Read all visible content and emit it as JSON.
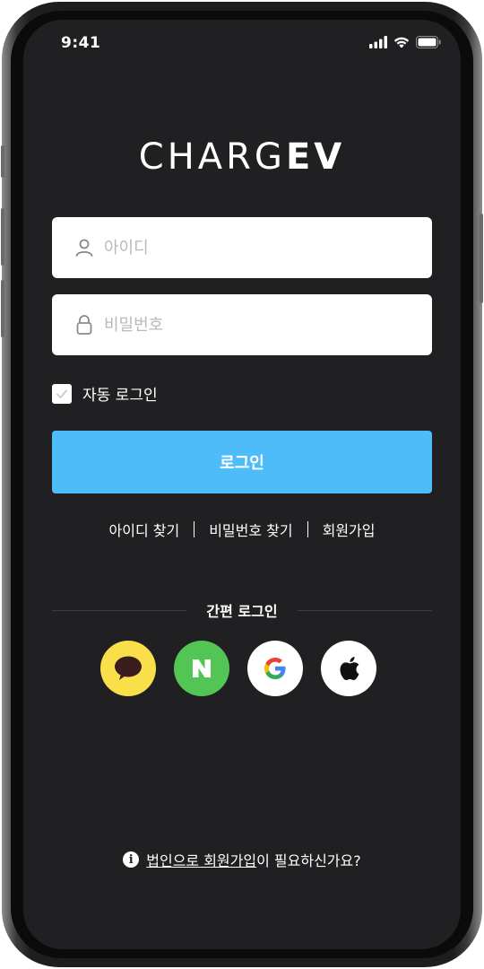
{
  "status_bar": {
    "time": "9:41",
    "icons": [
      "cellular-signal-icon",
      "wifi-icon",
      "battery-icon"
    ]
  },
  "logo": {
    "part_thin": "CHARG",
    "part_bold": "EV"
  },
  "login_form": {
    "id_field": {
      "placeholder": "아이디",
      "value": "",
      "icon": "user-icon"
    },
    "password_field": {
      "placeholder": "비밀번호",
      "value": "",
      "icon": "lock-icon"
    },
    "auto_login": {
      "label": "자동 로그인",
      "checked": true
    },
    "login_button": "로그인"
  },
  "links": {
    "find_id": "아이디 찾기",
    "find_password": "비밀번호 찾기",
    "sign_up": "회원가입"
  },
  "easy_login": {
    "title": "간편 로그인",
    "providers": [
      {
        "name": "kakao",
        "icon": "kakao-talk-icon",
        "color": "#f9e04b"
      },
      {
        "name": "naver",
        "icon": "naver-n-icon",
        "color": "#52c555"
      },
      {
        "name": "google",
        "icon": "google-g-icon",
        "color": "#ffffff"
      },
      {
        "name": "apple",
        "icon": "apple-icon",
        "color": "#ffffff"
      }
    ]
  },
  "footer": {
    "link_text": "법인으로 회원가입",
    "suffix_text": "이 필요하신가요?",
    "icon": "info-icon"
  },
  "colors": {
    "background": "#202022",
    "accent": "#4dbcf8"
  }
}
